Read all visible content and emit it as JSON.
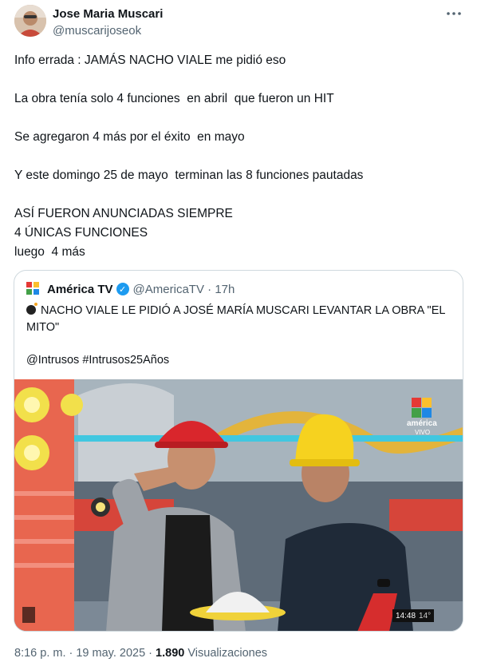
{
  "author": {
    "name": "Jose Maria Muscari",
    "handle": "@muscarijoseok"
  },
  "more_icon": "more-horizontal-icon",
  "tweet_paragraphs": [
    "Info errada : JAMÁS NACHO VIALE me pidió eso",
    "La obra tenía solo 4 funciones  en abril  que fueron un HIT",
    "Se agregaron 4 más por el éxito  en mayo",
    "Y este domingo 25 de mayo  terminan las 8 funciones pautadas",
    "ASÍ FUERON ANUNCIADAS SIEMPRE\n4 ÚNICAS FUNCIONES\nluego  4 más"
  ],
  "quoted": {
    "name": "América TV",
    "handle": "@AmericaTV",
    "time": "17h",
    "headline": "NACHO VIALE LE PIDIÓ A JOSÉ MARÍA MUSCARI LEVANTAR LA OBRA \"EL MITO\"",
    "hashtags": "@Intrusos #Intrusos25Años",
    "video": {
      "channel_label": "américa",
      "channel_sublabel": "VIVO",
      "clock": "14:48",
      "clock_suffix": "14°"
    }
  },
  "footer": {
    "timestamp": "8:16 p. m. · 19 may. 2025 ·",
    "views_count": "1.890",
    "views_label": "Visualizaciones"
  },
  "colors": {
    "verified": "#1d9bf0",
    "secondary_text": "#536471",
    "border": "#cfd9de"
  }
}
